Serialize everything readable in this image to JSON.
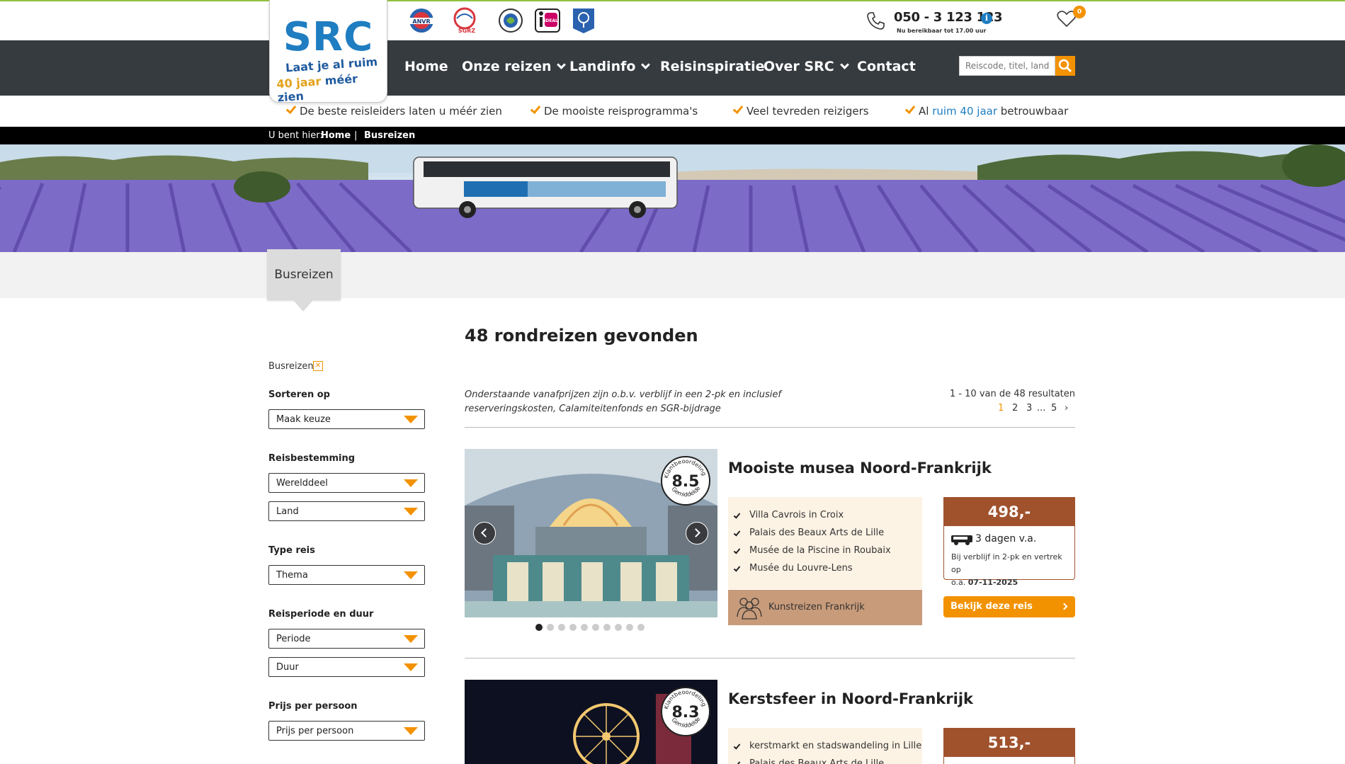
{
  "header": {
    "phone": "050 - 3 123 123",
    "phone_info_icon": "info-icon",
    "phone_hours": "Nu bereikbaar tot 17.00 uur",
    "favorites_count": "0",
    "partners": [
      "ANVR",
      "SGRZ",
      "Calamiteitenfonds",
      "iDEAL",
      "Keurmerk"
    ]
  },
  "logo": {
    "text": "SRC",
    "tagline_1": "Laat je al ruim",
    "tagline_2_prefix": "40 jaar ",
    "tagline_2_emph": "méér zien"
  },
  "nav": {
    "items": [
      {
        "label": "Home",
        "has_dropdown": false
      },
      {
        "label": "Onze reizen",
        "has_dropdown": true
      },
      {
        "label": "Landinfo",
        "has_dropdown": true
      },
      {
        "label": "Reisinspiratie",
        "has_dropdown": false
      },
      {
        "label": "Over SRC",
        "has_dropdown": true
      },
      {
        "label": "Contact",
        "has_dropdown": false
      }
    ],
    "search_placeholder": "Reiscode, titel, land"
  },
  "usps": {
    "u1": "De beste reisleiders laten u méér zien",
    "u2": "De mooiste reisprogramma's",
    "u3": "Veel tevreden reizigers",
    "u4_pre": "Al ",
    "u4_hl": "ruim 40 jaar",
    "u4_post": " betrouwbaar"
  },
  "breadcrumb": {
    "prefix": "U bent hier:",
    "items": [
      "Home",
      "Busreizen"
    ],
    "separator": "|"
  },
  "page": {
    "tab_title": "Busreizen",
    "results_title": "48 rondreizen gevonden",
    "price_note": "Onderstaande vanafprijzen zijn o.b.v. verblijf in een 2-pk en inclusief reserveringskosten, Calamiteitenfonds en SGR-bijdrage",
    "results_count": "1 - 10 van de 48 resultaten",
    "pagination": [
      "1",
      "2",
      "3",
      "...",
      "5"
    ],
    "active_page": "1"
  },
  "filters": {
    "active_chip": "Busreizen",
    "sort_label": "Sorteren op",
    "sort_value": "Maak keuze",
    "destination_label": "Reisbestemming",
    "continent_value": "Werelddeel",
    "country_value": "Land",
    "type_label": "Type reis",
    "type_value": "Thema",
    "period_label": "Reisperiode en duur",
    "period_value": "Periode",
    "duration_value": "Duur",
    "price_label": "Prijs per persoon",
    "price_value": "Prijs per persoon"
  },
  "trips": [
    {
      "title": "Mooiste musea Noord-Frankrijk",
      "score": "8.5",
      "score_ring_top": "Klantbeoordeling",
      "score_ring_bottom": "Gemiddelde",
      "highlights": [
        "Villa Cavrois in Croix",
        "Palais des Beaux Arts de Lille",
        "Musée de la Piscine in Roubaix",
        "Musée du Louvre-Lens"
      ],
      "theme": "Kunstreizen Frankrijk",
      "price": "498,-",
      "days": "3 dagen v.a.",
      "price_sub_1": "Bij verblijf in 2-pk en vertrek op",
      "price_sub_2_pre": "o.a. ",
      "price_sub_2_date": "07-11-2025",
      "cta": "Bekijk deze reis",
      "slide_count": 10,
      "active_slide": 0
    },
    {
      "title": "Kerstsfeer in Noord-Frankrijk",
      "score": "8.3",
      "score_ring_top": "Klantbeoordeling",
      "score_ring_bottom": "Gemiddelde",
      "highlights": [
        "kerstmarkt en stadswandeling in Lille",
        "Palais des Beaux Arts de Lille"
      ],
      "price": "513,-"
    }
  ],
  "colors": {
    "accent": "#f39200",
    "brand_blue": "#1f7dc1",
    "nav_bg": "#363b40",
    "price_brown": "#a0522d",
    "highlight_bg": "#fdf3e5",
    "theme_bg": "#c89b7a"
  }
}
